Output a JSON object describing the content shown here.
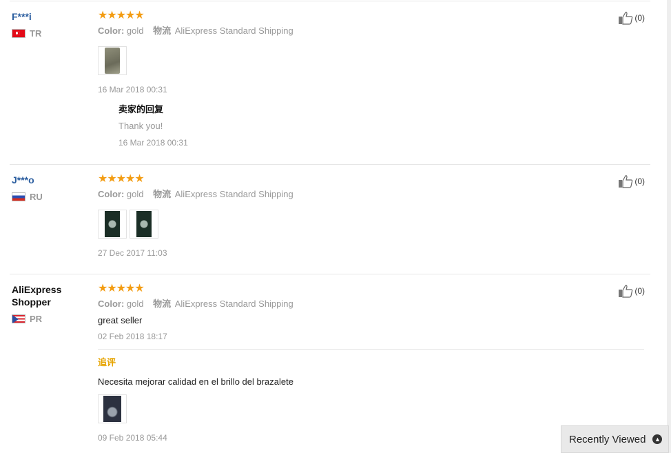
{
  "reviews": [
    {
      "user": "F***i",
      "country": "TR",
      "stars": "★★★★★",
      "color_label": "Color:",
      "color_value": "gold",
      "shipping_label": "物流",
      "shipping_value": "AliExpress Standard Shipping",
      "date": "16 Mar 2018 00:31",
      "helpful": "(0)",
      "reply": {
        "title": "卖家的回复",
        "text": "Thank you!",
        "date": "16 Mar 2018 00:31"
      }
    },
    {
      "user": "J***o",
      "country": "RU",
      "stars": "★★★★★",
      "color_label": "Color:",
      "color_value": "gold",
      "shipping_label": "物流",
      "shipping_value": "AliExpress Standard Shipping",
      "date": "27 Dec 2017 11:03",
      "helpful": "(0)"
    },
    {
      "user": "AliExpress Shopper",
      "country": "PR",
      "stars": "★★★★★",
      "color_label": "Color:",
      "color_value": "gold",
      "shipping_label": "物流",
      "shipping_value": "AliExpress Standard Shipping",
      "text": "great seller",
      "date": "02 Feb 2018 18:17",
      "helpful": "(0)",
      "followup": {
        "label": "追评",
        "text": "Necesita mejorar calidad en el brillo del brazalete",
        "date": "09 Feb 2018 05:44"
      }
    }
  ],
  "recently_viewed": "Recently Viewed",
  "colors": {
    "star": "#f39c12",
    "user_link": "#2a5d9f",
    "followup": "#e6a400",
    "muted": "#999999"
  },
  "icons": [
    "thumbs-up-icon",
    "chevron-up-icon"
  ]
}
